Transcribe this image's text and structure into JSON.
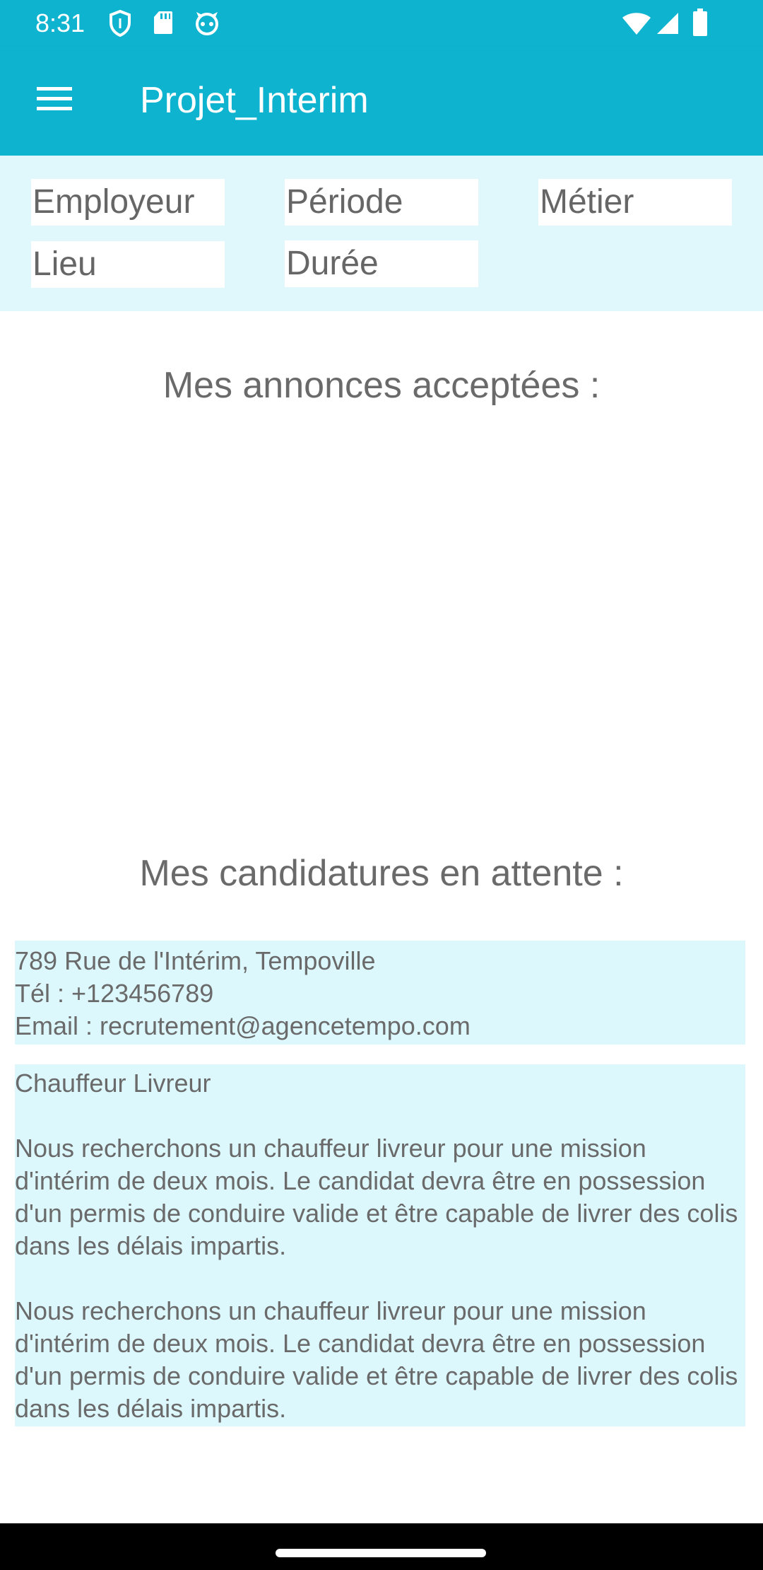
{
  "status_bar": {
    "time": "8:31",
    "icons_left": [
      "shield-icon",
      "sd-card-icon",
      "notification-face-icon"
    ],
    "icons_right": [
      "wifi-icon",
      "cell-signal-icon",
      "battery-icon"
    ]
  },
  "app_bar": {
    "menu_icon": "hamburger-menu-icon",
    "title": "Projet_Interim"
  },
  "filters": {
    "employeur": "Employeur",
    "periode": "Période",
    "metier": "Métier",
    "lieu": "Lieu",
    "duree": "Durée"
  },
  "accepted": {
    "title": "Mes annonces acceptées :"
  },
  "pending": {
    "title": "Mes candidatures en attente :",
    "card1": {
      "lines": [
        "789 Rue de l'Intérim, Tempoville",
        "Tél : +123456789",
        "Email : recrutement@agencetempo.com"
      ]
    },
    "card2": {
      "job_title": "Chauffeur Livreur",
      "description": "Nous recherchons un chauffeur livreur pour une mission d'intérim de deux mois. Le candidat devra être en possession d'un permis de conduire valide et être capable de livrer des colis dans les délais impartis.",
      "description_repeat": "Nous recherchons un chauffeur livreur pour une mission d'intérim de deux mois. Le candidat devra être en possession d'un permis de conduire valide et être capable de livrer des colis dans les délais impartis."
    }
  },
  "colors": {
    "primary": "#0eb3cf",
    "filter_bg": "#e0f8fc",
    "card_bg": "#ddf8fd"
  }
}
